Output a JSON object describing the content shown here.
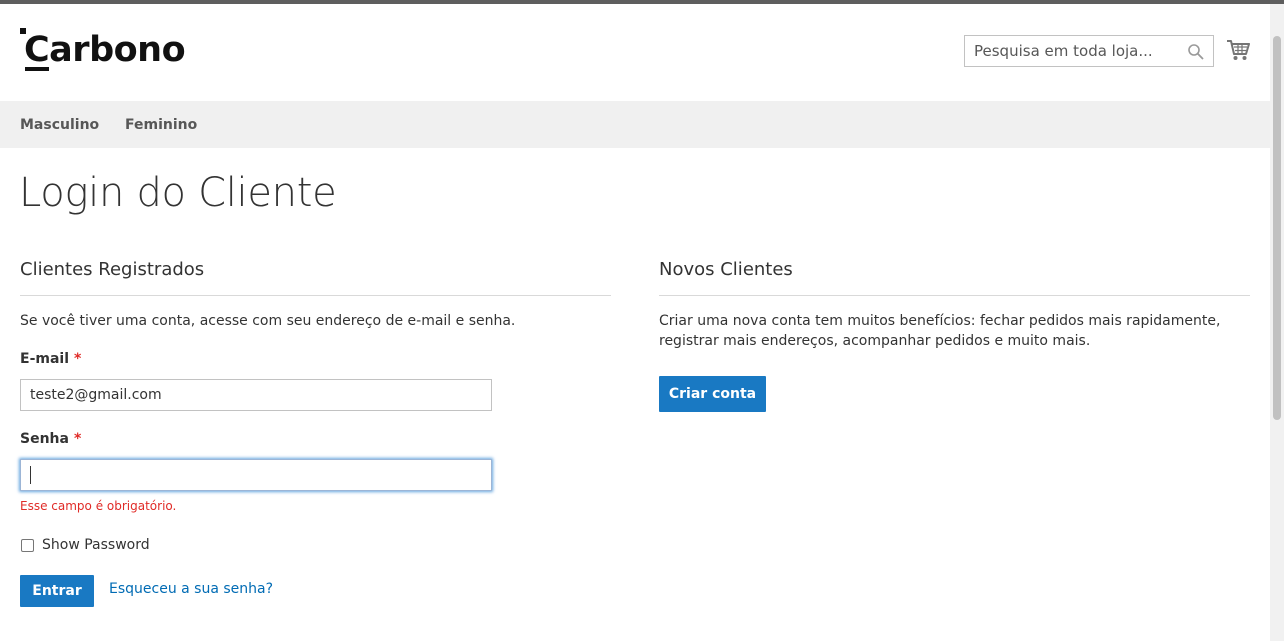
{
  "header": {
    "logo_text": "Carbono",
    "search": {
      "placeholder": "Pesquisa em toda loja..."
    }
  },
  "nav": {
    "items": [
      "Masculino",
      "Feminino"
    ]
  },
  "page": {
    "title": "Login do Cliente"
  },
  "registered": {
    "title": "Clientes Registrados",
    "intro": "Se você tiver uma conta, acesse com seu endereço de e-mail e senha.",
    "email_label": "E-mail",
    "email_value": "teste2@gmail.com",
    "password_label": "Senha",
    "password_value": "",
    "required_mark": "*",
    "error": "Esse campo é obrigatório.",
    "show_password_label": "Show Password",
    "show_password_checked": false,
    "submit_label": "Entrar",
    "forgot_label": "Esqueceu a sua senha?"
  },
  "new_customers": {
    "title": "Novos Clientes",
    "text": "Criar uma nova conta tem muitos benefícios: fechar pedidos mais rapidamente, registrar mais endereços, acompanhar pedidos e muito mais.",
    "button_label": "Criar conta"
  },
  "colors": {
    "primary": "#1979c3",
    "link": "#006bb4",
    "error": "#e02b27",
    "nav_bg": "#f0f0f0"
  },
  "icons": [
    "search-icon",
    "cart-icon"
  ]
}
